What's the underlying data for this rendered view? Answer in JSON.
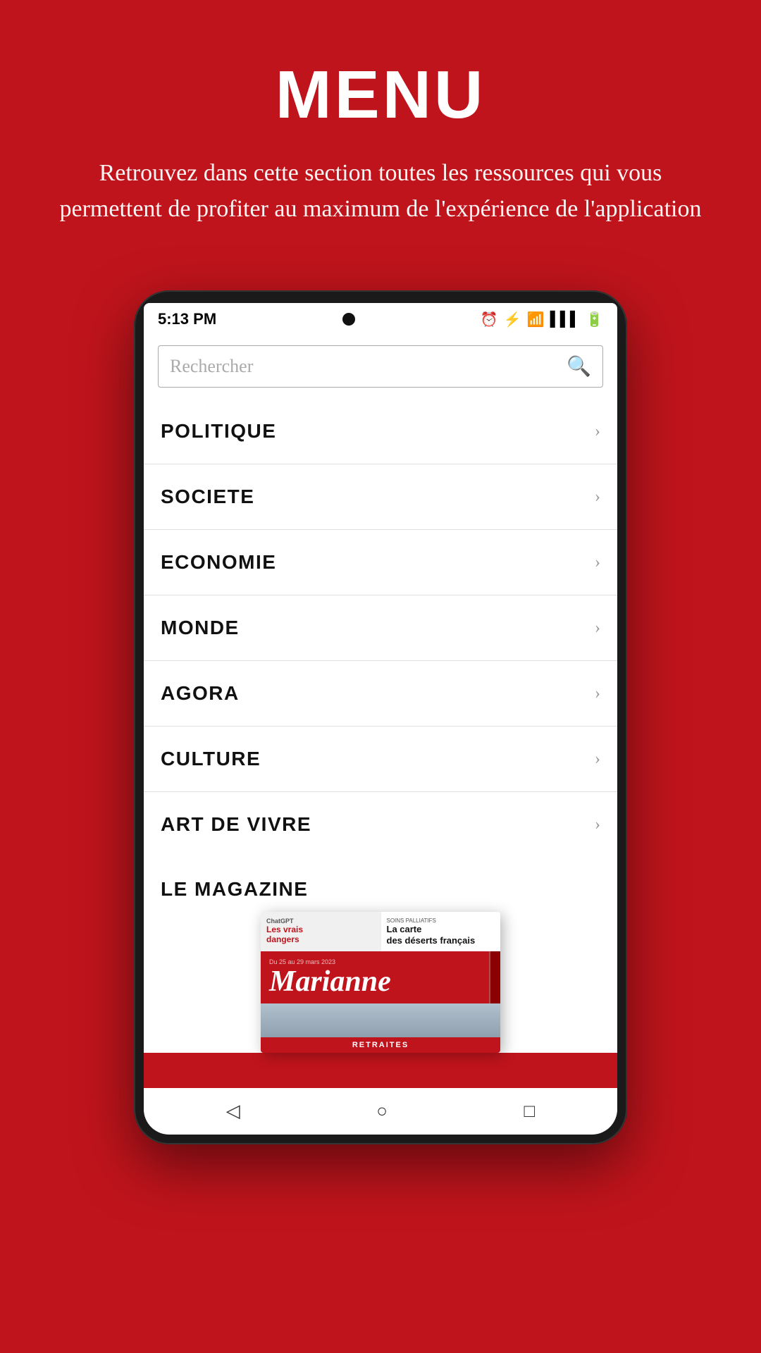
{
  "header": {
    "title": "MENU",
    "subtitle": "Retrouvez dans cette section toutes les ressources qui vous permettent de profiter au maximum de l'expérience de l'application"
  },
  "status_bar": {
    "time": "5:13 PM",
    "icons": [
      "⏰",
      "⚡",
      "WiFi",
      "📶",
      "🔋"
    ]
  },
  "search": {
    "placeholder": "Rechercher",
    "icon": "🔍"
  },
  "menu_items": [
    {
      "label": "POLITIQUE"
    },
    {
      "label": "SOCIETE"
    },
    {
      "label": "ECONOMIE"
    },
    {
      "label": "MONDE"
    },
    {
      "label": "AGORA"
    },
    {
      "label": "CULTURE"
    },
    {
      "label": "ART DE VIVRE"
    }
  ],
  "magazine": {
    "section_label": "LE MAGAZINE",
    "cover": {
      "chatgpt_label": "ChatGPT",
      "danger_label": "Les vrais dangers",
      "soins_label": "SOINS PALLIATIFS",
      "carte_label": "La carte des déserts français",
      "logo": "Marianne",
      "retraites_label": "RETRAITES"
    }
  },
  "nav_bar": {
    "back_icon": "◁",
    "home_icon": "○",
    "square_icon": "□"
  }
}
